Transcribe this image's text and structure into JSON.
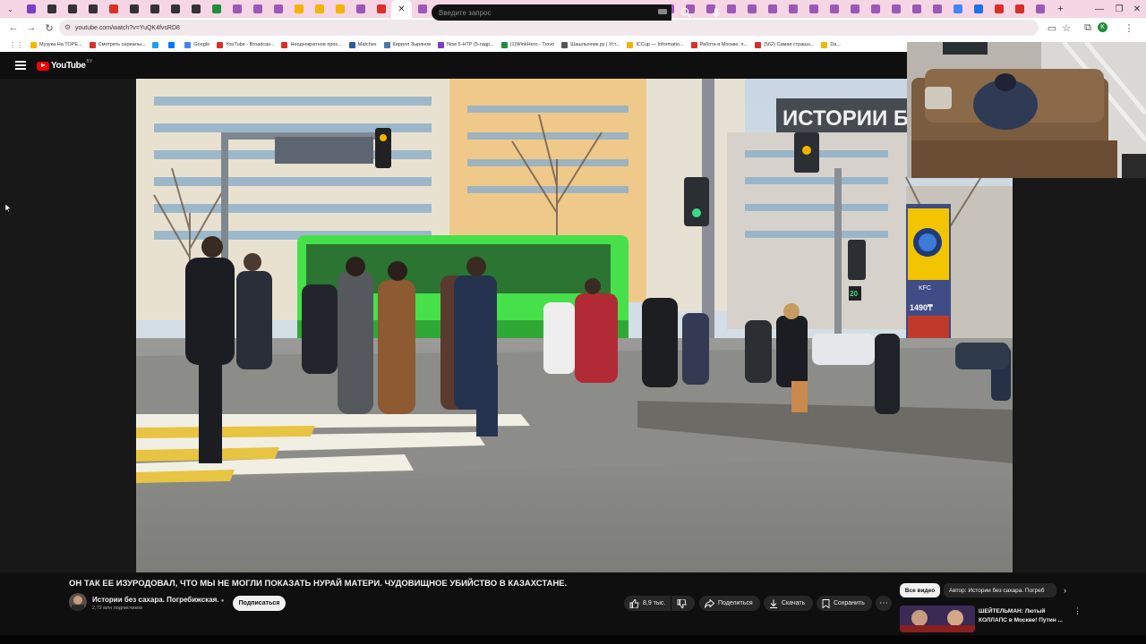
{
  "browser": {
    "tabs": [
      {
        "color": "#7b3fc4"
      },
      {
        "color": "#333333"
      },
      {
        "color": "#333333"
      },
      {
        "color": "#333333"
      },
      {
        "color": "#d93025"
      },
      {
        "color": "#333333"
      },
      {
        "color": "#333333"
      },
      {
        "color": "#333333"
      },
      {
        "color": "#333333"
      },
      {
        "color": "#1e8e3e"
      },
      {
        "color": "#9b59b6"
      },
      {
        "color": "#9b59b6"
      },
      {
        "color": "#9b59b6"
      },
      {
        "color": "#f4b400"
      },
      {
        "color": "#f4b400"
      },
      {
        "color": "#f4b400"
      },
      {
        "color": "#9b59b6"
      },
      {
        "color": "#d93025"
      },
      {
        "color": "#f4b400"
      },
      {
        "color": "#9b59b6"
      },
      {
        "color": "#9b59b6"
      },
      {
        "color": "#9b59b6"
      },
      {
        "color": "#9b59b6"
      },
      {
        "color": "#9b59b6"
      },
      {
        "color": "#9b59b6"
      },
      {
        "color": "#9b59b6"
      },
      {
        "color": "#9b59b6"
      },
      {
        "color": "#9b59b6"
      },
      {
        "color": "#9b59b6"
      },
      {
        "color": "#9b59b6"
      },
      {
        "color": "#9b59b6"
      },
      {
        "color": "#9b59b6"
      },
      {
        "color": "#9b59b6"
      },
      {
        "color": "#9b59b6"
      },
      {
        "color": "#9b59b6"
      },
      {
        "color": "#9b59b6"
      },
      {
        "color": "#9b59b6"
      },
      {
        "color": "#9b59b6"
      },
      {
        "color": "#9b59b6"
      },
      {
        "color": "#9b59b6"
      },
      {
        "color": "#9b59b6"
      },
      {
        "color": "#9b59b6"
      },
      {
        "color": "#9b59b6"
      },
      {
        "color": "#9b59b6"
      },
      {
        "color": "#9b59b6"
      },
      {
        "color": "#4285f4"
      },
      {
        "color": "#1a73e8"
      },
      {
        "color": "#d93025"
      },
      {
        "color": "#d93025"
      },
      {
        "color": "#9b59b6"
      }
    ],
    "active_tab_index": 18,
    "url": "youtube.com/watch?v=YuQK4fvsRD8",
    "bookmarks": [
      {
        "label": "Музука На ТОРЕ...",
        "color": "#f4b400"
      },
      {
        "label": "Смотреть сериалы...",
        "color": "#d93025"
      },
      {
        "label": "",
        "color": "#1da1f2"
      },
      {
        "label": "",
        "color": "#0077ff"
      },
      {
        "label": "Google",
        "color": "#4285f4"
      },
      {
        "label": "YouTube - Broadcas...",
        "color": "#d93025"
      },
      {
        "label": "Неоднократное прох...",
        "color": "#d93025"
      },
      {
        "label": "Matches",
        "color": "#2c5aa0"
      },
      {
        "label": "Кирилл Зырянов",
        "color": "#4a76a8"
      },
      {
        "label": "Now 5-HTP (5-гидр...",
        "color": "#7b3fc4"
      },
      {
        "label": "(1)WinkHero - Trovo",
        "color": "#1e8e3e"
      },
      {
        "label": "Шашлычник.ру | Уст...",
        "color": "#555555"
      },
      {
        "label": "ICCup — Informatio...",
        "color": "#f4b400"
      },
      {
        "label": "Работа в Москве, п...",
        "color": "#d93025"
      },
      {
        "label": "(562) Самая страшн...",
        "color": "#d93025"
      },
      {
        "label": "Da...",
        "color": "#f4b400"
      }
    ]
  },
  "youtube": {
    "logo_text": "YouTube",
    "logo_country": "BY",
    "search_placeholder": "Введите запрос",
    "video": {
      "overlay_text": "ИСТОРИИ БЕЗ",
      "sign_price": "1490₸",
      "sign_brand": "KFC",
      "signal_count": "20",
      "title": "ОН ТАК ЕЕ ИЗУРОДОВАЛ, ЧТО МЫ НЕ МОГЛИ ПОКАЗАТЬ НУРАЙ МАТЕРИ. ЧУДОВИЩНОЕ УБИЙСТВО В КАЗАХСТАНЕ."
    },
    "channel": {
      "name": "Истории без сахара. Погребижская.",
      "subscribers": "2,72 млн подписчиков",
      "subscribe_label": "Подписаться"
    },
    "actions": {
      "likes": "8,9 тыс.",
      "share": "Поделиться",
      "download": "Скачать",
      "save": "Сохранить"
    },
    "chips": {
      "all": "Все видео",
      "author": "Автор: Истории без сахара. Погреб"
    },
    "recommendation": {
      "title": "ШЕЙТЕЛЬМАН: Лютый КОЛЛАПС в Москве! Путин ..."
    }
  }
}
